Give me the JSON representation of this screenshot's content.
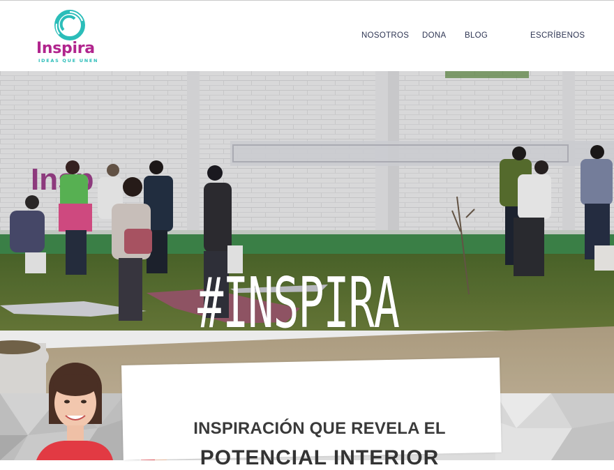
{
  "brand": {
    "name": "Inspira",
    "tagline": "IDEAS QUE UNEN",
    "colors": {
      "primary": "#b1248d",
      "accent": "#2bbdb9",
      "nav_text": "#2e3553"
    }
  },
  "nav": {
    "items": [
      {
        "label": "NOSOTROS"
      },
      {
        "label": "DONA"
      },
      {
        "label": "BLOG"
      },
      {
        "label": "ESCRÍBENOS"
      }
    ]
  },
  "hero": {
    "title": "#INSPIRA",
    "wall_logo_text": "Insp"
  },
  "intro": {
    "heading_line1": "INSPIRACIÓN QUE REVELA EL",
    "heading_line2": "POTENCIAL INTERIOR"
  }
}
